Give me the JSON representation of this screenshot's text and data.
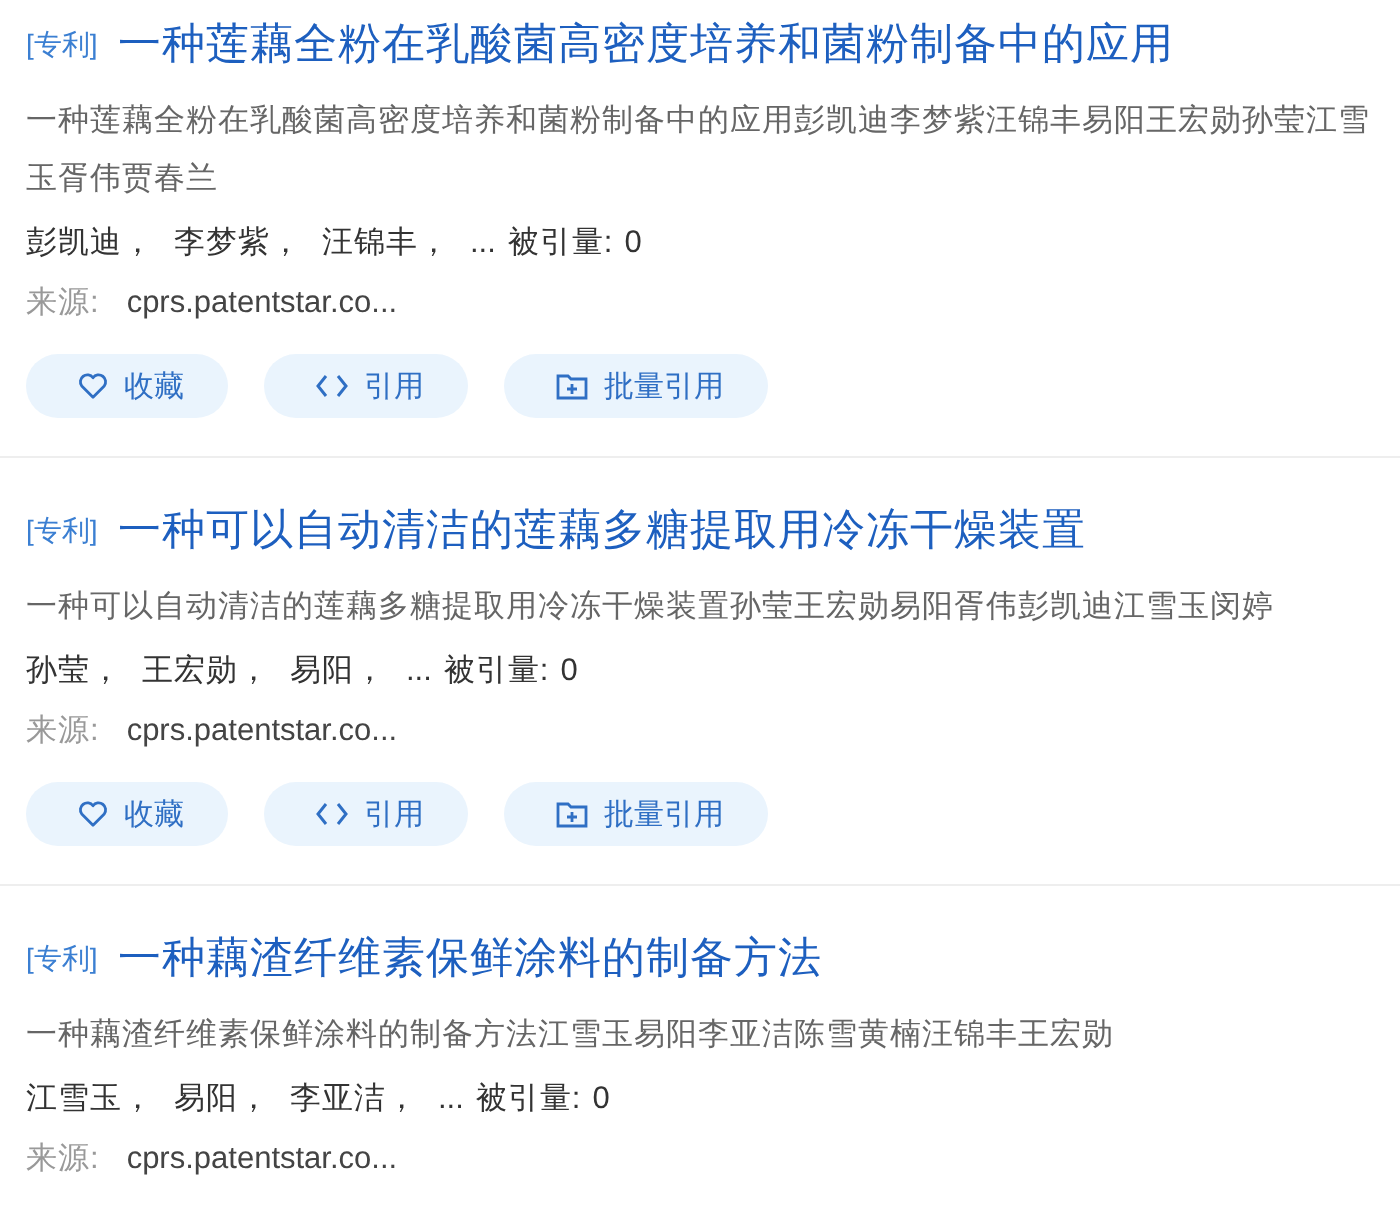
{
  "results": [
    {
      "tag": "[专利]",
      "title": "一种莲藕全粉在乳酸菌高密度培养和菌粉制备中的应用",
      "abstract": "一种莲藕全粉在乳酸菌高密度培养和菌粉制备中的应用彭凯迪李梦紫汪锦丰易阳王宏勋孙莹江雪玉胥伟贾春兰",
      "authors": [
        "彭凯迪，",
        "李梦紫，",
        "汪锦丰，"
      ],
      "more": "...",
      "cited_label": "被引量:",
      "cited": "0",
      "source_label": "来源:",
      "source": "cprs.patentstar.co...",
      "buttons": [
        {
          "kind": "favorite",
          "label": "收藏"
        },
        {
          "kind": "cite",
          "label": "引用"
        },
        {
          "kind": "batch",
          "label": "批量引用"
        }
      ]
    },
    {
      "tag": "[专利]",
      "title": "一种可以自动清洁的莲藕多糖提取用冷冻干燥装置",
      "abstract": "一种可以自动清洁的莲藕多糖提取用冷冻干燥装置孙莹王宏勋易阳胥伟彭凯迪江雪玉闵婷",
      "authors": [
        "孙莹，",
        "王宏勋，",
        "易阳，"
      ],
      "more": "...",
      "cited_label": "被引量:",
      "cited": "0",
      "source_label": "来源:",
      "source": "cprs.patentstar.co...",
      "buttons": [
        {
          "kind": "favorite",
          "label": "收藏"
        },
        {
          "kind": "cite",
          "label": "引用"
        },
        {
          "kind": "batch",
          "label": "批量引用"
        }
      ]
    },
    {
      "tag": "[专利]",
      "title": "一种藕渣纤维素保鲜涂料的制备方法",
      "abstract": "一种藕渣纤维素保鲜涂料的制备方法江雪玉易阳李亚洁陈雪黄楠汪锦丰王宏勋",
      "authors": [
        "江雪玉，",
        "易阳，",
        "李亚洁，"
      ],
      "more": "...",
      "cited_label": "被引量:",
      "cited": "0",
      "source_label": "来源:",
      "source": "cprs.patentstar.co..."
    }
  ]
}
